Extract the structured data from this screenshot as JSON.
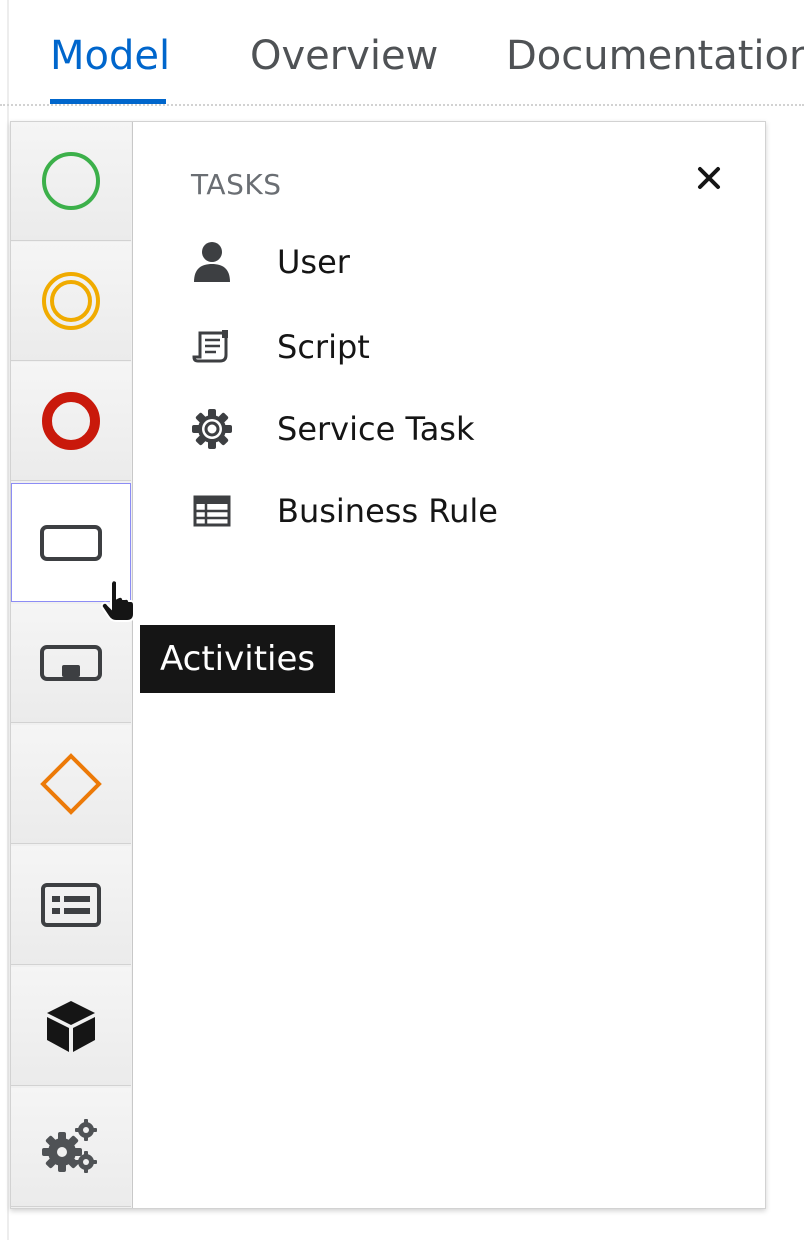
{
  "tabs": {
    "items": [
      {
        "label": "Model",
        "active": true
      },
      {
        "label": "Overview",
        "active": false
      },
      {
        "label": "Documentation",
        "active": false
      }
    ]
  },
  "palette": {
    "categories": [
      {
        "icon": "start-event-icon",
        "color": "#3cb04a"
      },
      {
        "icon": "intermediate-event-icon",
        "color": "#f0ab00"
      },
      {
        "icon": "end-event-icon",
        "color": "#c9190b"
      },
      {
        "icon": "activity-icon",
        "color": "#4f5255",
        "selected": true
      },
      {
        "icon": "subprocess-icon",
        "color": "#4f5255"
      },
      {
        "icon": "gateway-icon",
        "color": "#ec7a08"
      },
      {
        "icon": "container-icon",
        "color": "#4f5255"
      },
      {
        "icon": "artifact-cube-icon",
        "color": "#151515"
      },
      {
        "icon": "custom-tasks-gears-icon",
        "color": "#4f5255"
      }
    ]
  },
  "flyout": {
    "section_title": "TASKS",
    "close_label": "×",
    "items": [
      {
        "label": "User",
        "icon": "user-icon"
      },
      {
        "label": "Script",
        "icon": "script-icon"
      },
      {
        "label": "Service Task",
        "icon": "service-gear-icon"
      },
      {
        "label": "Business Rule",
        "icon": "business-rule-table-icon"
      }
    ]
  },
  "tooltip": {
    "text": "Activities"
  }
}
